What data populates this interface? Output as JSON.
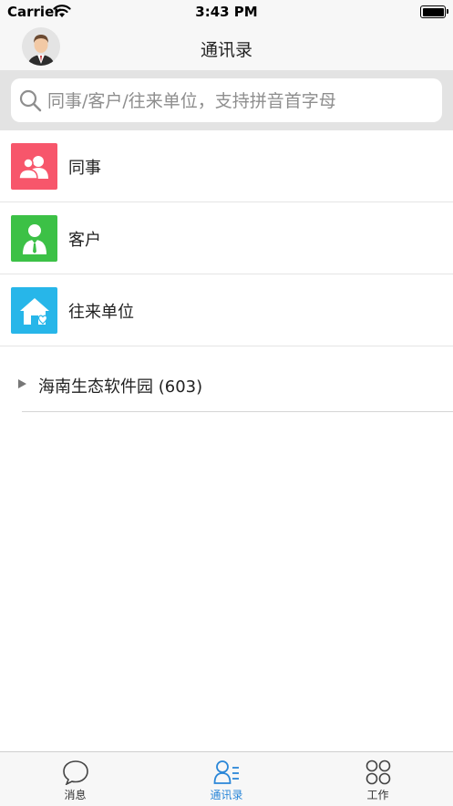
{
  "status_bar": {
    "carrier": "Carrier",
    "time": "3:43 PM"
  },
  "nav": {
    "title": "通讯录"
  },
  "search": {
    "placeholder": "同事/客户/往来单位，支持拼音首字母"
  },
  "menu": [
    {
      "label": "同事",
      "icon": "colleagues-icon",
      "color": "#f7566b"
    },
    {
      "label": "客户",
      "icon": "customer-icon",
      "color": "#3cc146"
    },
    {
      "label": "往来单位",
      "icon": "company-icon",
      "color": "#27b6e9"
    }
  ],
  "group": {
    "label": "海南生态软件园 (603)"
  },
  "tabs": [
    {
      "label": "消息",
      "icon": "chat-bubble-icon"
    },
    {
      "label": "通讯录",
      "icon": "contacts-icon",
      "active": true
    },
    {
      "label": "工作",
      "icon": "apps-icon"
    }
  ],
  "colors": {
    "accent": "#2b87d8",
    "search_bg": "#e3e3e3"
  }
}
